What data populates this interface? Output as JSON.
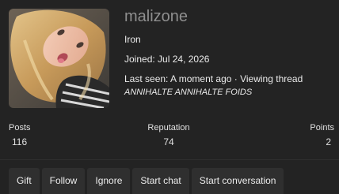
{
  "profile": {
    "username": "malizone",
    "user_title": "Iron",
    "joined_label": "Joined:",
    "joined_date": "Jul 24, 2026",
    "last_seen_label": "Last seen:",
    "last_seen_value": "A moment ago · Viewing thread",
    "viewing_thread": "ANNIHALTE ANNIHALTE FOIDS",
    "avatar_icon": "user-avatar"
  },
  "stats": {
    "posts_label": "Posts",
    "posts_value": "116",
    "reputation_label": "Reputation",
    "reputation_value": "74",
    "points_label": "Points",
    "points_value": "2"
  },
  "actions": {
    "gift": "Gift",
    "follow": "Follow",
    "ignore": "Ignore",
    "start_chat": "Start chat",
    "start_conversation": "Start conversation"
  },
  "colors": {
    "background": "#232323",
    "button_bg": "#2f2f2f",
    "username": "#8f8f8f"
  }
}
